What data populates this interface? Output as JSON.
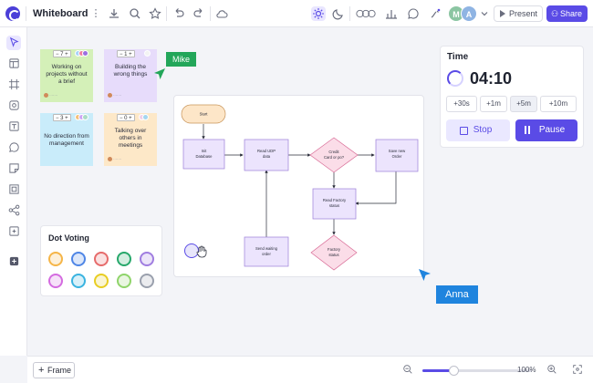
{
  "app": {
    "title": "Whiteboard",
    "accent_color": "#5a4be6"
  },
  "toolbar": {
    "icons": [
      "more-vertical-icon",
      "download-icon",
      "search-icon",
      "star-icon",
      "undo-icon",
      "redo-icon",
      "cloud-icon"
    ],
    "right_icons": [
      "sun-icon",
      "moon-icon",
      "reactions-icon",
      "chart-icon",
      "comment-icon",
      "draw-icon"
    ],
    "avatars": [
      {
        "initial": "M",
        "color": "#8bc5a2"
      },
      {
        "initial": "A",
        "color": "#8fb4e3"
      }
    ],
    "present_label": "Present",
    "share_label": "Share"
  },
  "left_tools": [
    "select-tool-icon",
    "template-icon",
    "frame-tool-icon",
    "shape-tool-icon",
    "text-tool-icon",
    "comment-tool-icon",
    "sticky-note-icon",
    "media-icon",
    "mindmap-icon",
    "integration-icon",
    "add-tool-icon"
  ],
  "stickies": [
    {
      "text": "Working on projects without a brief",
      "votes": "7",
      "color": "#d4f0b8",
      "dots": [
        "#a8d4f8",
        "#f07ea0",
        "#9a6ee0"
      ]
    },
    {
      "text": "Building the wrong things",
      "votes": "1",
      "color": "#e7dcfb",
      "dots": [
        "#f3f3f3"
      ]
    },
    {
      "text": "No direction from management",
      "votes": "3",
      "color": "#c9ecfa",
      "dots": [
        "#f4c07a",
        "#cfa5f6",
        "#aadcc6"
      ]
    },
    {
      "text": "Talking over others in meetings",
      "votes": "0",
      "color": "#fde8c8",
      "dots": [
        "#f0d0e8",
        "#a4d6f0"
      ]
    }
  ],
  "cursors": {
    "mike": {
      "name": "Mike",
      "color": "#23a65a"
    },
    "anna": {
      "name": "Anna",
      "color": "#1f84de"
    }
  },
  "timer": {
    "label": "Time",
    "time": "04:10",
    "quick_options": [
      "+30s",
      "+1m",
      "+5m",
      "+10m"
    ],
    "selected_option": "+5m",
    "stop_label": "Stop",
    "pause_label": "Pause"
  },
  "flowchart": {
    "start": "Start",
    "init_db": [
      "Init",
      "Database"
    ],
    "read_udp": [
      "Read UDP",
      "data"
    ],
    "credit": [
      "Credit",
      "Card or po?"
    ],
    "save_order": [
      "Save new",
      "Order"
    ],
    "read_factory": [
      "Read Factory",
      "status"
    ],
    "send_waiting": [
      "Send waiting",
      "order"
    ],
    "factory_status": [
      "Factory",
      "status"
    ]
  },
  "dot_voting": {
    "title": "Dot Voting",
    "row1": [
      "#f5b548",
      "#4f86e6",
      "#e66b6b",
      "#27a86b",
      "#a07de0"
    ],
    "row2": [
      "#d46be0",
      "#39b3e0",
      "#e8cd22",
      "#8fd46a",
      "#9aa0ad"
    ]
  },
  "bottom": {
    "frame_label": "Frame",
    "zoom_text": "100%",
    "zoom_level": 0.28
  }
}
